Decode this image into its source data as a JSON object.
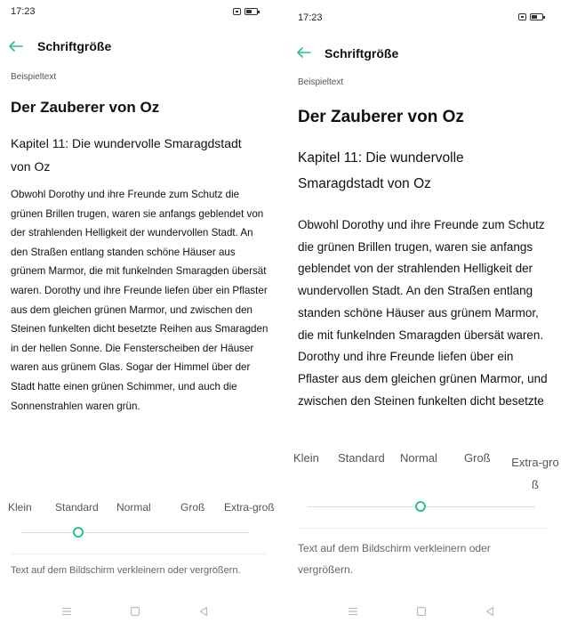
{
  "left": {
    "status": {
      "time": "17:23"
    },
    "toolbar": {
      "title": "Schriftgröße"
    },
    "preview": {
      "section_label": "Beispieltext",
      "book_title": "Der Zauberer von Oz",
      "chapter_title": "Kapitel 11: Die wundervolle Smaragdstadt von Oz",
      "body": "Obwohl Dorothy und ihre Freunde zum Schutz die grünen Brillen trugen, waren sie anfangs geblendet von der strahlenden Helligkeit der wundervollen Stadt. An den Straßen entlang standen schöne Häuser aus grünem Marmor, die mit funkelnden Smaragden übersät waren. Dorothy und ihre Freunde liefen über ein Pflaster aus dem gleichen grünen Marmor, und zwischen den Steinen funkelten dicht besetzte Reihen aus Smaragden in der hellen Sonne. Die Fensterscheiben der Häuser waren aus grünem Glas. Sogar der Himmel über der Stadt hatte einen grünen Schimmer, und auch die Sonnenstrahlen waren grün."
    },
    "font_sizes": {
      "labels": [
        "Klein",
        "Standard",
        "Normal",
        "Groß",
        "Extra-groß"
      ],
      "selected_index": 1
    },
    "hint": "Text auf dem Bildschirm verkleinern oder vergrößern."
  },
  "right": {
    "status": {
      "time": "17:23"
    },
    "toolbar": {
      "title": "Schriftgröße"
    },
    "preview": {
      "section_label": "Beispieltext",
      "book_title": "Der Zauberer von Oz",
      "chapter_title": "Kapitel 11: Die wundervolle Smaragdstadt von Oz",
      "body": "Obwohl Dorothy und ihre Freunde zum Schutz die grünen Brillen trugen, waren sie anfangs geblendet von der strahlenden Helligkeit der wundervollen Stadt. An den Straßen entlang standen schöne Häuser aus grünem Marmor, die mit funkelnden Smaragden übersät waren. Dorothy und ihre Freunde liefen über ein Pflaster aus dem gleichen grünen Marmor, und zwischen den Steinen funkelten dicht besetzte Reihen"
    },
    "font_sizes": {
      "labels": [
        "Klein",
        "Standard",
        "Normal",
        "Groß",
        "Extra-groß"
      ],
      "selected_index": 2
    },
    "hint": "Text auf dem Bildschirm verkleinern oder vergrößern."
  },
  "colors": {
    "accent": "#2bbf91",
    "text": "#111111",
    "secondary_text": "#555555"
  },
  "icons": {
    "back": "arrow-left-icon",
    "sim": "sim-card-icon",
    "battery": "battery-icon",
    "nav_menu": "menu-icon",
    "nav_home": "home-square-icon",
    "nav_back": "triangle-back-icon"
  }
}
